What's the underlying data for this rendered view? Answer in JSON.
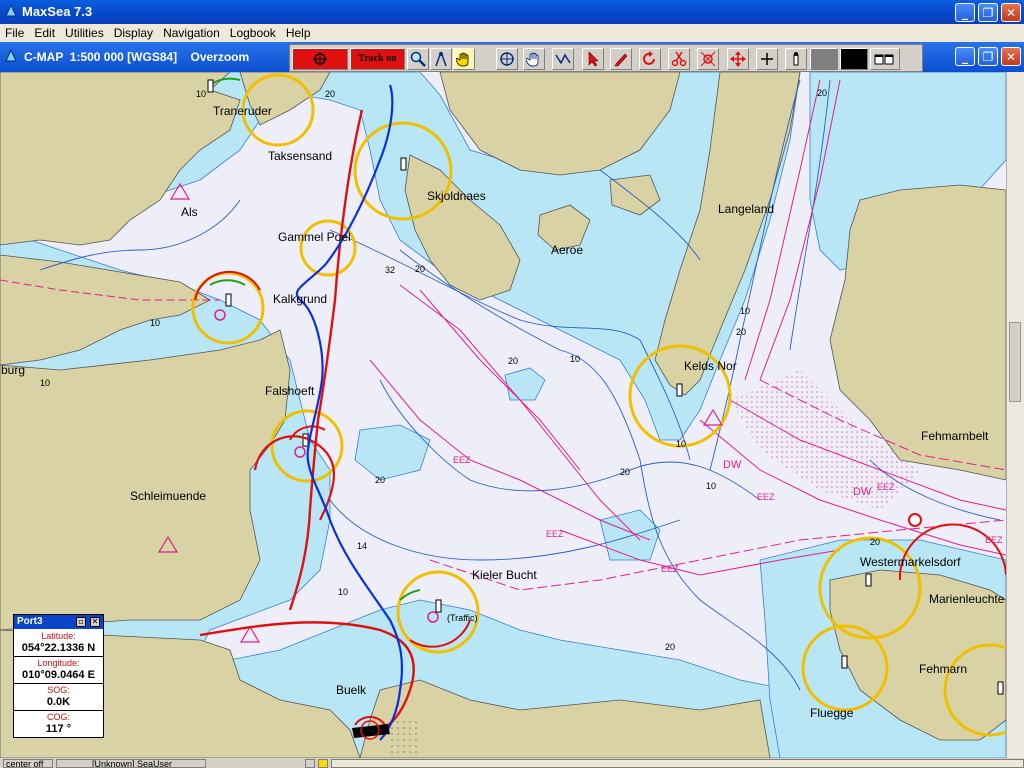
{
  "window": {
    "title": "MaxSea 7.3"
  },
  "menu": [
    "File",
    "Edit",
    "Utilities",
    "Display",
    "Navigation",
    "Logbook",
    "Help"
  ],
  "chart_window": {
    "title": "C-MAP  1:500 000 [WGS84]    Overzoom"
  },
  "toolbar": {
    "track_label": "Track on"
  },
  "places": {
    "traneruder": "Traneruder",
    "taksensand": "Taksensand",
    "als": "Als",
    "skjoldnaes": "Skjoldnaes",
    "gammel_poel": "Gammel Poel",
    "aeroe": "Aeroe",
    "langeland": "Langeland",
    "kalkgrund": "Kalkgrund",
    "burg": "burg",
    "keldsnor": "Kelds Nor",
    "fehmarnbelt": "Fehmarnbelt",
    "falshoeft": "Falshoeft",
    "schleimuende": "Schleimuende",
    "westermarkelsdorf": "Westermarkelsdorf",
    "marienleuchte": "Marienleuchte",
    "kieler_bucht": "Kieler Bucht",
    "fehmarn": "Fehmarn",
    "buelk": "Buelk",
    "fluegge": "Fluegge",
    "traffic": "(Traffic)"
  },
  "depths": {
    "d32": "32",
    "d20a": "20",
    "d10a": "10",
    "d10b": "10",
    "d20b": "20",
    "d10c": "10",
    "d20c": "20",
    "d10d": "10",
    "d20d": "20",
    "d14": "14",
    "d10e": "10",
    "d20e": "20",
    "d20f": "20",
    "d10f": "10",
    "d20g": "20",
    "d10g": "10",
    "d20h": "20",
    "d10h": "10",
    "d20i": "20"
  },
  "zones": {
    "eez1": "EEZ",
    "eez2": "EEZ",
    "eez3": "EEZ",
    "eez4": "EEZ",
    "eez5": "EEZ",
    "eez6": "EEZ",
    "dw1": "DW",
    "dw2": "DW"
  },
  "port_panel": {
    "title": "Port3",
    "latitude_label": "Latitude:",
    "latitude": "054°22.1336 N",
    "longitude_label": "Longitude:",
    "longitude": "010°09.0464 E",
    "sog_label": "SOG:",
    "sog": "0.0K",
    "cog_label": "COG:",
    "cog": "117 °"
  },
  "status": {
    "mode": "center off",
    "user": "[Unknown] SeaUser"
  },
  "colors": {
    "land": "#d8d2a4",
    "shallow": "#b8e6f4",
    "deep": "#eeeef8",
    "route_red": "#e01010",
    "track_blue": "#0830e0",
    "zone_magenta": "#e0208c",
    "light_ring": "#f0c000"
  }
}
